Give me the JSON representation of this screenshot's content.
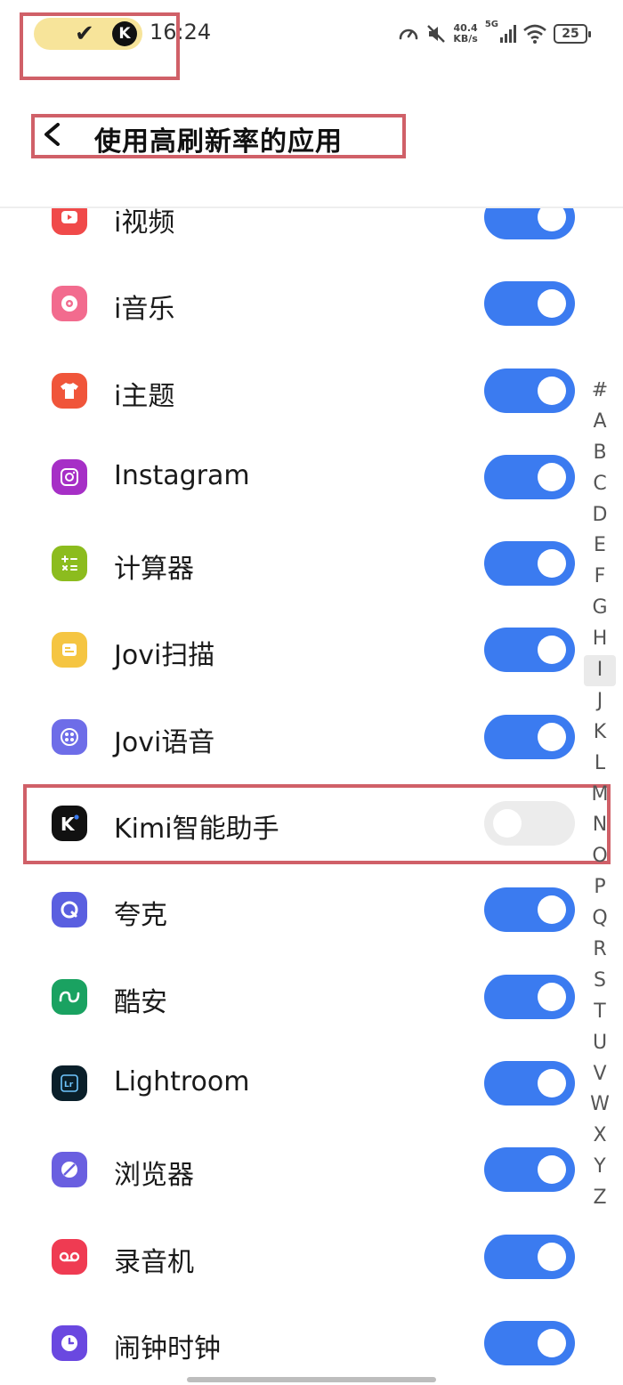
{
  "status_bar": {
    "time": "16:24",
    "net_speed_value": "40.4",
    "net_speed_unit": "KB/s",
    "network_type": "5G",
    "battery": "25"
  },
  "header": {
    "title": "使用高刷新率的应用"
  },
  "apps": [
    {
      "name": "i视频",
      "enabled": true,
      "icon": "video-play-icon",
      "color": "#f04a4a"
    },
    {
      "name": "i音乐",
      "enabled": true,
      "icon": "music-disc-icon",
      "color": "#f26b8e"
    },
    {
      "name": "i主题",
      "enabled": true,
      "icon": "tshirt-icon",
      "color": "#f0553a"
    },
    {
      "name": "Instagram",
      "enabled": true,
      "icon": "instagram-icon",
      "color": "#a62fc6"
    },
    {
      "name": "计算器",
      "enabled": true,
      "icon": "calculator-icon",
      "color": "#8cbc1e"
    },
    {
      "name": "Jovi扫描",
      "enabled": true,
      "icon": "scan-icon",
      "color": "#f5c542"
    },
    {
      "name": "Jovi语音",
      "enabled": true,
      "icon": "voice-assistant-icon",
      "color": "#6e6de8"
    },
    {
      "name": "Kimi智能助手",
      "enabled": false,
      "icon": "kimi-icon",
      "color": "#111111"
    },
    {
      "name": "夸克",
      "enabled": true,
      "icon": "quark-icon",
      "color": "#5a5fe0"
    },
    {
      "name": "酷安",
      "enabled": true,
      "icon": "coolapk-icon",
      "color": "#1aa261"
    },
    {
      "name": "Lightroom",
      "enabled": true,
      "icon": "lightroom-icon",
      "color": "#0a1f2a"
    },
    {
      "name": "浏览器",
      "enabled": true,
      "icon": "browser-icon",
      "color": "#6a5fe0"
    },
    {
      "name": "录音机",
      "enabled": true,
      "icon": "recorder-icon",
      "color": "#ef3b52"
    },
    {
      "name": "闹钟时钟",
      "enabled": true,
      "icon": "clock-icon",
      "color": "#6a48e0"
    }
  ],
  "alphabet_index": [
    "#",
    "A",
    "B",
    "C",
    "D",
    "E",
    "F",
    "G",
    "H",
    "I",
    "J",
    "K",
    "L",
    "M",
    "N",
    "O",
    "P",
    "Q",
    "R",
    "S",
    "T",
    "U",
    "V",
    "W",
    "X",
    "Y",
    "Z"
  ],
  "alphabet_active": "I",
  "colors": {
    "toggle_on": "#3b7bf0",
    "toggle_off": "#ececec",
    "annotation_box": "#d06068"
  }
}
